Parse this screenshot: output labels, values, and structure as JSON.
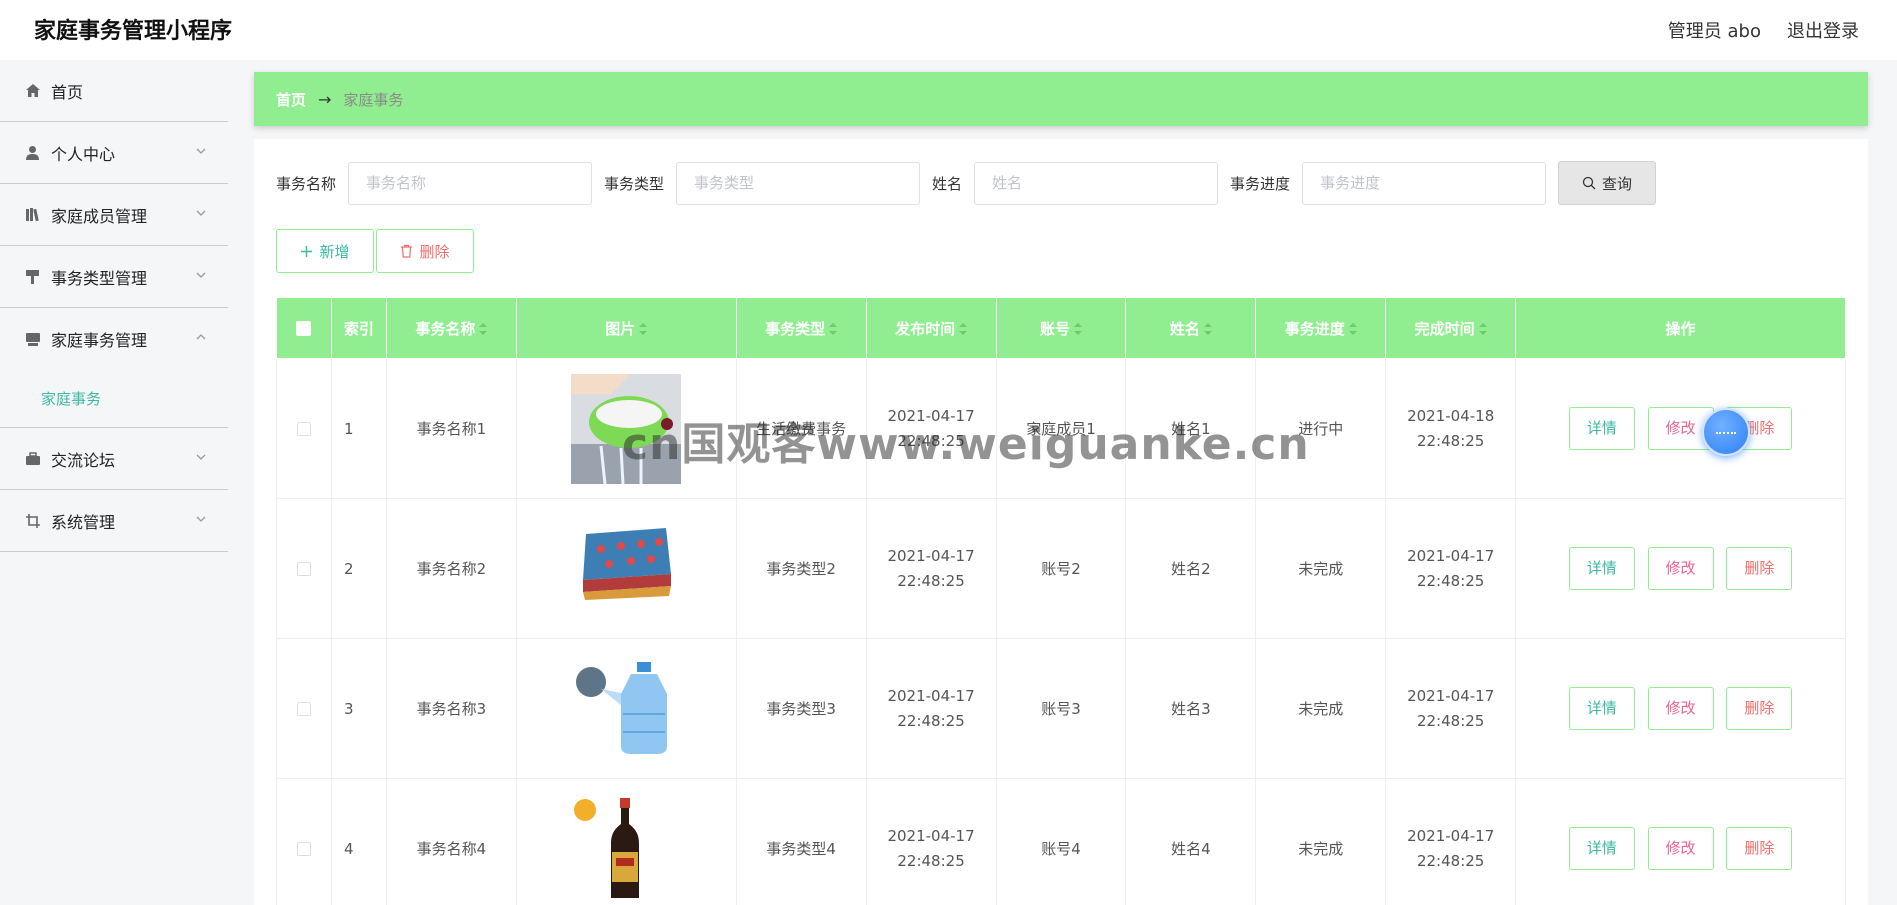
{
  "header": {
    "title": "家庭事务管理小程序",
    "user": "管理员 abo",
    "logout": "退出登录"
  },
  "sidebar": {
    "items": [
      {
        "label": "首页",
        "icon": "home-icon"
      },
      {
        "label": "个人中心",
        "icon": "user-icon"
      },
      {
        "label": "家庭成员管理",
        "icon": "books-icon"
      },
      {
        "label": "事务类型管理",
        "icon": "brush-icon"
      },
      {
        "label": "家庭事务管理",
        "icon": "tray-icon"
      },
      {
        "label": "交流论坛",
        "icon": "briefcase-icon"
      },
      {
        "label": "系统管理",
        "icon": "crop-icon"
      }
    ],
    "sub_item": "家庭事务"
  },
  "breadcrumb": {
    "home": "首页",
    "arrow": "→",
    "current": "家庭事务"
  },
  "search": {
    "labels": [
      "事务名称",
      "事务类型",
      "姓名",
      "事务进度"
    ],
    "placeholders": [
      "事务名称",
      "事务类型",
      "姓名",
      "事务进度"
    ],
    "query": "查询"
  },
  "actions": {
    "add": "新增",
    "delete": "删除"
  },
  "table": {
    "headers": [
      "索引",
      "事务名称",
      "图片",
      "事务类型",
      "发布时间",
      "账号",
      "姓名",
      "事务进度",
      "完成时间",
      "操作"
    ],
    "rows": [
      {
        "index": "1",
        "name": "事务名称1",
        "type": "生活缴费事务",
        "publish": "2021-04-17 22:48:25",
        "account": "家庭成员1",
        "person": "姓名1",
        "progress": "进行中",
        "finish": "2021-04-18 22:48:25"
      },
      {
        "index": "2",
        "name": "事务名称2",
        "type": "事务类型2",
        "publish": "2021-04-17 22:48:25",
        "account": "账号2",
        "person": "姓名2",
        "progress": "未完成",
        "finish": "2021-04-17 22:48:25"
      },
      {
        "index": "3",
        "name": "事务名称3",
        "type": "事务类型3",
        "publish": "2021-04-17 22:48:25",
        "account": "账号3",
        "person": "姓名3",
        "progress": "未完成",
        "finish": "2021-04-17 22:48:25"
      },
      {
        "index": "4",
        "name": "事务名称4",
        "type": "事务类型4",
        "publish": "2021-04-17 22:48:25",
        "account": "账号4",
        "person": "姓名4",
        "progress": "未完成",
        "finish": "2021-04-17 22:48:25"
      }
    ],
    "ops": {
      "detail": "详情",
      "edit": "修改",
      "delete": "删除"
    }
  },
  "watermark": "cn国观客www.weiguanke.cn",
  "colors": {
    "accent": "#90ee90",
    "teal": "#3cb8a4",
    "danger": "#f56c6c",
    "pink": "#f06292"
  }
}
